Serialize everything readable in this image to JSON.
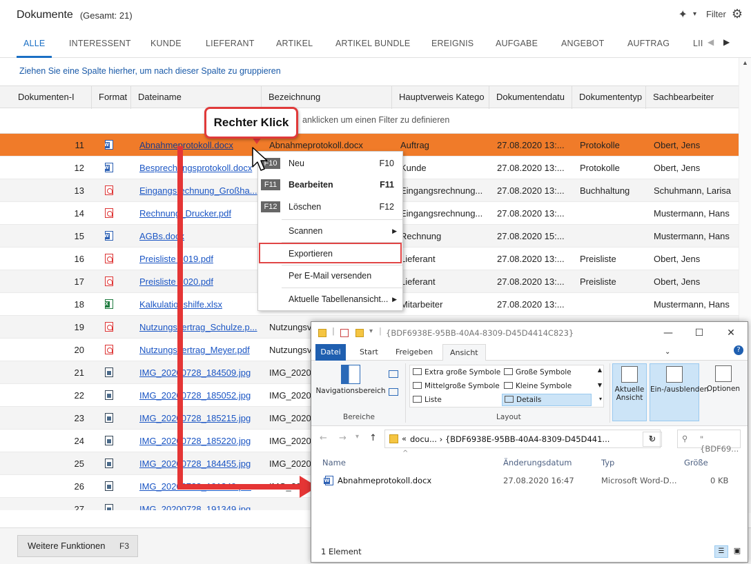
{
  "header": {
    "title": "Dokumente",
    "count": "(Gesamt: 21)",
    "filter": "Filter"
  },
  "tabs": [
    "ALLE",
    "INTERESSENT",
    "KUNDE",
    "LIEFERANT",
    "ARTIKEL",
    "ARTIKEL BUNDLE",
    "EREIGNIS",
    "AUFGABE",
    "ANGEBOT",
    "AUFTRAG",
    "LII"
  ],
  "group_hint": "Ziehen Sie eine Spalte hierher, um nach dieser Spalte zu gruppieren",
  "columns": [
    "Dokumenten-I",
    "Format",
    "Dateiname",
    "Bezeichnung",
    "Hauptverweis Katego",
    "Dokumentendatu",
    "Dokumententyp",
    "Sachbearbeiter"
  ],
  "filter_hint": "anklicken um einen Filter zu definieren",
  "rows": [
    {
      "id": "11",
      "fmt": "doc",
      "file": "Abnahmeprotokoll.docx",
      "bez": "Abnahmeprotokoll.docx",
      "haupt": "Auftrag",
      "datum": "27.08.2020 13:...",
      "typ": "Protokolle",
      "sach": "Obert, Jens"
    },
    {
      "id": "12",
      "fmt": "doc",
      "file": "Besprechungsprotokoll.docx",
      "bez": "",
      "haupt": "Kunde",
      "datum": "27.08.2020 13:...",
      "typ": "Protokolle",
      "sach": "Obert, Jens"
    },
    {
      "id": "13",
      "fmt": "pdf",
      "file": "Eingangsrechnung_Großha...",
      "bez": "",
      "haupt": "Eingangsrechnung...",
      "datum": "27.08.2020 13:...",
      "typ": "Buchhaltung",
      "sach": "Schuhmann, Larisa"
    },
    {
      "id": "14",
      "fmt": "pdf",
      "file": "Rechnung_Drucker.pdf",
      "bez": "",
      "haupt": "Eingangsrechnung...",
      "datum": "27.08.2020 13:...",
      "typ": "",
      "sach": "Mustermann, Hans"
    },
    {
      "id": "15",
      "fmt": "doc",
      "file": "AGBs.docx",
      "bez": "",
      "haupt": "Rechnung",
      "datum": "27.08.2020 15:...",
      "typ": "",
      "sach": "Mustermann, Hans"
    },
    {
      "id": "16",
      "fmt": "pdf",
      "file": "Preisliste 2019.pdf",
      "bez": "",
      "haupt": "Lieferant",
      "datum": "27.08.2020 13:...",
      "typ": "Preisliste",
      "sach": "Obert, Jens"
    },
    {
      "id": "17",
      "fmt": "pdf",
      "file": "Preisliste 2020.pdf",
      "bez": "",
      "haupt": "Lieferant",
      "datum": "27.08.2020 13:...",
      "typ": "Preisliste",
      "sach": "Obert, Jens"
    },
    {
      "id": "18",
      "fmt": "xls",
      "file": "Kalkulationshilfe.xlsx",
      "bez": "",
      "haupt": "Mitarbeiter",
      "datum": "27.08.2020 13:...",
      "typ": "",
      "sach": "Mustermann, Hans"
    },
    {
      "id": "19",
      "fmt": "pdf",
      "file": "Nutzungsvertrag_Schulze.p...",
      "bez": "Nutzungsv",
      "haupt": "",
      "datum": "",
      "typ": "",
      "sach": ""
    },
    {
      "id": "20",
      "fmt": "pdf",
      "file": "Nutzungsvertrag_Meyer.pdf",
      "bez": "Nutzungsv",
      "haupt": "",
      "datum": "",
      "typ": "",
      "sach": ""
    },
    {
      "id": "21",
      "fmt": "img",
      "file": "IMG_20200728_184509.jpg",
      "bez": "IMG_20200",
      "haupt": "",
      "datum": "",
      "typ": "",
      "sach": ""
    },
    {
      "id": "22",
      "fmt": "img",
      "file": "IMG_20200728_185052.jpg",
      "bez": "IMG_20200",
      "haupt": "",
      "datum": "",
      "typ": "",
      "sach": ""
    },
    {
      "id": "23",
      "fmt": "img",
      "file": "IMG_20200728_185215.jpg",
      "bez": "IMG_20200",
      "haupt": "",
      "datum": "",
      "typ": "",
      "sach": ""
    },
    {
      "id": "24",
      "fmt": "img",
      "file": "IMG_20200728_185220.jpg",
      "bez": "IMG_20200",
      "haupt": "",
      "datum": "",
      "typ": "",
      "sach": ""
    },
    {
      "id": "25",
      "fmt": "img",
      "file": "IMG_20200728_184455.jpg",
      "bez": "IMG_20200",
      "haupt": "",
      "datum": "",
      "typ": "",
      "sach": ""
    },
    {
      "id": "26",
      "fmt": "img",
      "file": "IMG_20200728_191349.p...",
      "bez": "IMG_20200",
      "haupt": "",
      "datum": "",
      "typ": "",
      "sach": ""
    },
    {
      "id": "27",
      "fmt": "img",
      "file": "IMG_20200728_191349.jpg",
      "bez": "",
      "haupt": "",
      "datum": "",
      "typ": "",
      "sach": ""
    }
  ],
  "footer": {
    "more": "Weitere Funktionen",
    "key": "F3"
  },
  "context_menu": {
    "new": {
      "key": "F10",
      "label": "Neu",
      "shortcut": "F10"
    },
    "edit": {
      "key": "F11",
      "label": "Bearbeiten",
      "shortcut": "F11"
    },
    "delete": {
      "key": "F12",
      "label": "Löschen",
      "shortcut": "F12"
    },
    "scan": "Scannen",
    "export": "Exportieren",
    "email": "Per E-Mail versenden",
    "tableview": "Aktuelle Tabellenansicht..."
  },
  "callout": "Rechter Klick",
  "explorer": {
    "title": "{BDF6938E-95BB-40A4-8309-D45D4414C823}",
    "ribbon_tabs": [
      "Datei",
      "Start",
      "Freigeben",
      "Ansicht"
    ],
    "nav_pane": "Navigationsbereich",
    "group_bereiche": "Bereiche",
    "layout": [
      "Extra große Symbole",
      "Große Symbole",
      "Mittelgroße Symbole",
      "Kleine Symbole",
      "Liste",
      "Details"
    ],
    "group_layout": "Layout",
    "current_view": "Aktuelle Ansicht",
    "show_hide": "Ein-/ausblenden",
    "options": "Optionen",
    "address": "docu...  ›  {BDF6938E-95BB-40A4-8309-D45D441...",
    "address_prefix": "«",
    "search_placeholder": "\"{BDF69...",
    "cols": [
      "Name",
      "Änderungsdatum",
      "Typ",
      "Größe"
    ],
    "file": {
      "name": "Abnahmeprotokoll.docx",
      "date": "27.08.2020 16:47",
      "type": "Microsoft Word-D...",
      "size": "0 KB"
    },
    "status": "1 Element"
  },
  "colors": {
    "accent": "#1a6fc4",
    "selected_row": "#f07b29",
    "annotation_red": "#e53535"
  }
}
